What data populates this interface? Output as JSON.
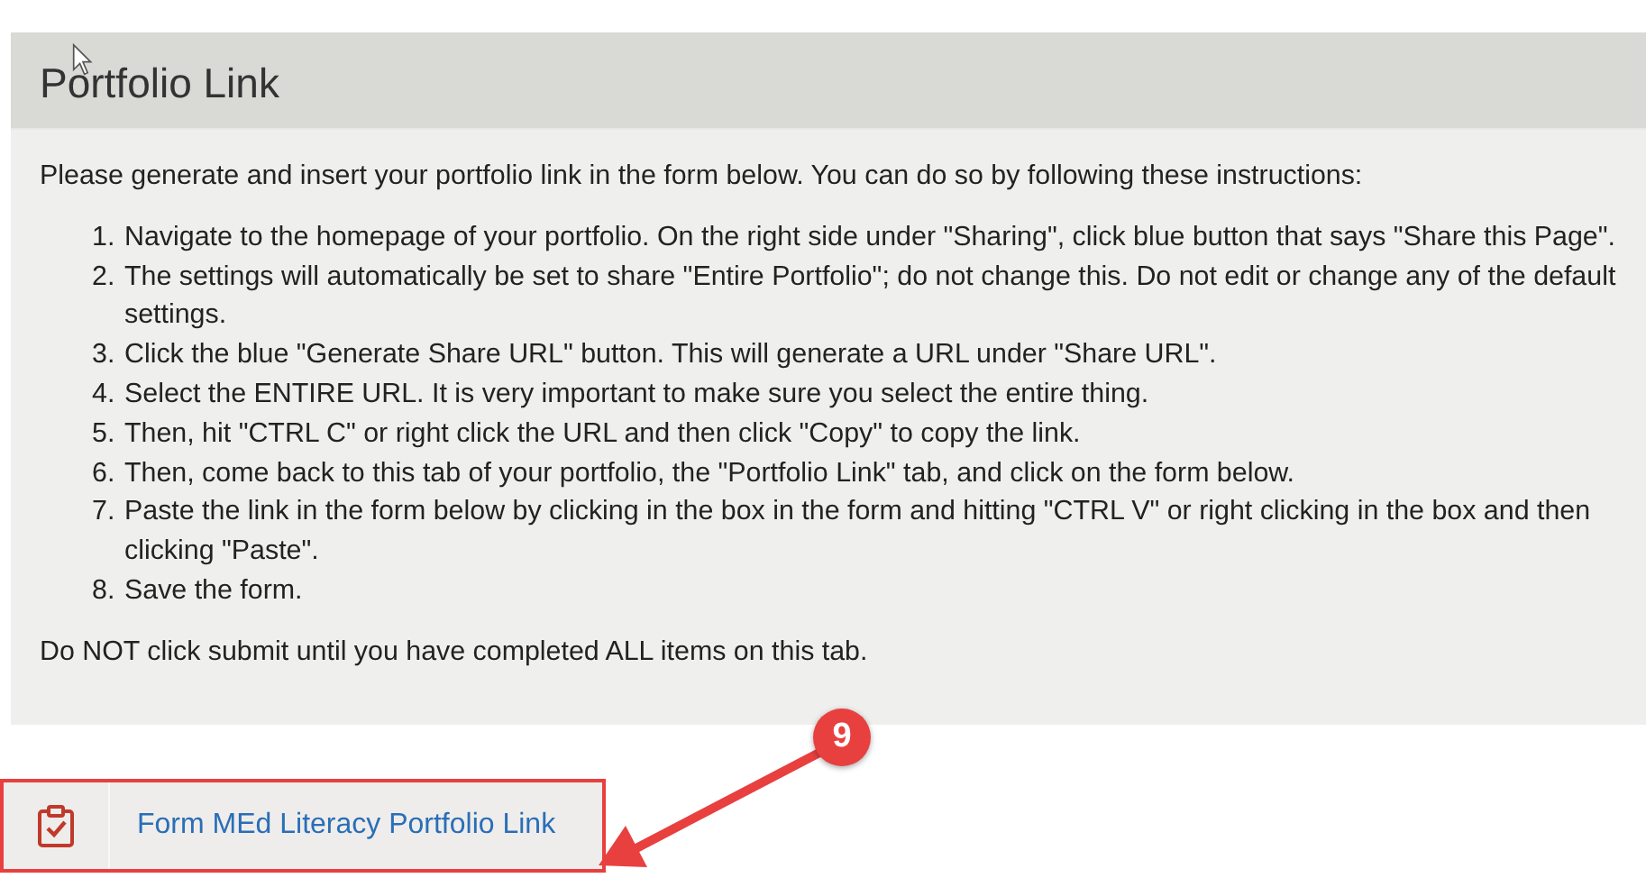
{
  "panel": {
    "title": "Portfolio Link",
    "intro": "Please generate and insert your portfolio link in the form below.  You can do so by following these instructions:",
    "steps": [
      {
        "number": "1.",
        "text": "Navigate to the homepage of your portfolio. On the right side under \"Sharing\", click blue button that says \"Share this Page\"."
      },
      {
        "number": "2.",
        "text": "The settings will automatically be set to share \"Entire Portfolio\"; do not change this. Do not edit or change any of the default settings."
      },
      {
        "number": "3.",
        "text": "Click the blue \"Generate Share URL\" button. This will generate a URL under \"Share URL\"."
      },
      {
        "number": "4.",
        "text": "Select the ENTIRE URL. It is very important to make sure you select the entire thing."
      },
      {
        "number": "5.",
        "text": "Then, hit \"CTRL C\" or right click the URL and then click \"Copy\" to copy the link."
      },
      {
        "number": "6.",
        "text": "Then, come back to this tab of your portfolio, the \"Portfolio Link\" tab, and click on the form below."
      },
      {
        "number": "7.",
        "text": "Paste the link in the form below by clicking in the box in the form and hitting \"CTRL V\" or right clicking in the box and then clicking \"Paste\"."
      },
      {
        "number": "8.",
        "text": "Save the form."
      }
    ],
    "closing": "Do NOT click submit until you have completed ALL items on this tab."
  },
  "form_link": {
    "label": "Form MEd Literacy Portfolio Link",
    "highlighted": true
  },
  "callout": {
    "number": "9"
  }
}
